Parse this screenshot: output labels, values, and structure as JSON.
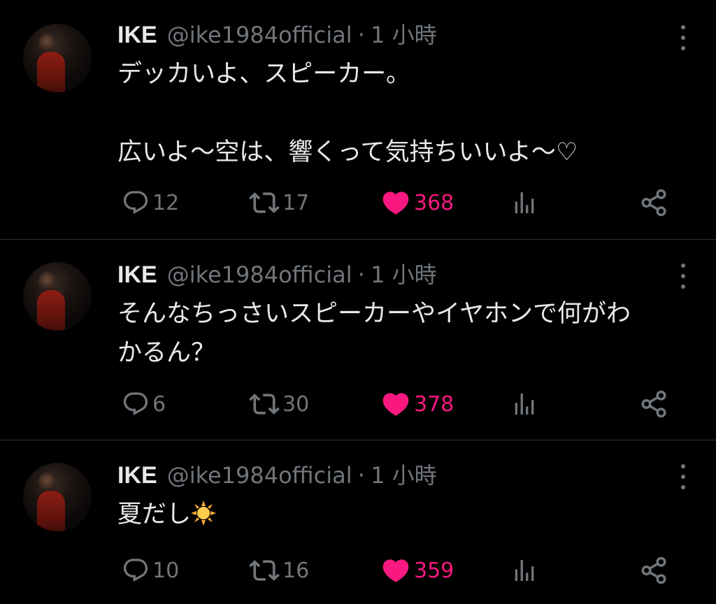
{
  "colors": {
    "background": "#000000",
    "primary_text": "#e7e9ea",
    "secondary_text": "#71767b",
    "like_active": "#f91880",
    "divider": "#2f3336"
  },
  "tweets": [
    {
      "author_name": "IKE",
      "handle": "@ike1984official",
      "separator": "·",
      "time": "1 小時",
      "text": "デッカいよ、スピーカー。\n\n広いよ〜空は、響くって気持ちいいよ〜♡",
      "reply_count": "12",
      "retweet_count": "17",
      "like_count": "368",
      "liked": true,
      "icons": [
        "reply-icon",
        "retweet-icon",
        "heart-icon",
        "views-icon",
        "share-icon"
      ]
    },
    {
      "author_name": "IKE",
      "handle": "@ike1984official",
      "separator": "·",
      "time": "1 小時",
      "text": "そんなちっさいスピーカーやイヤホンで何がわ\nかるん？",
      "reply_count": "6",
      "retweet_count": "30",
      "like_count": "378",
      "liked": true,
      "icons": [
        "reply-icon",
        "retweet-icon",
        "heart-icon",
        "views-icon",
        "share-icon"
      ]
    },
    {
      "author_name": "IKE",
      "handle": "@ike1984official",
      "separator": "·",
      "time": "1 小時",
      "text": "夏だし",
      "emoji": "sun-emoji",
      "reply_count": "10",
      "retweet_count": "16",
      "like_count": "359",
      "liked": true,
      "icons": [
        "reply-icon",
        "retweet-icon",
        "heart-icon",
        "views-icon",
        "share-icon"
      ]
    }
  ]
}
